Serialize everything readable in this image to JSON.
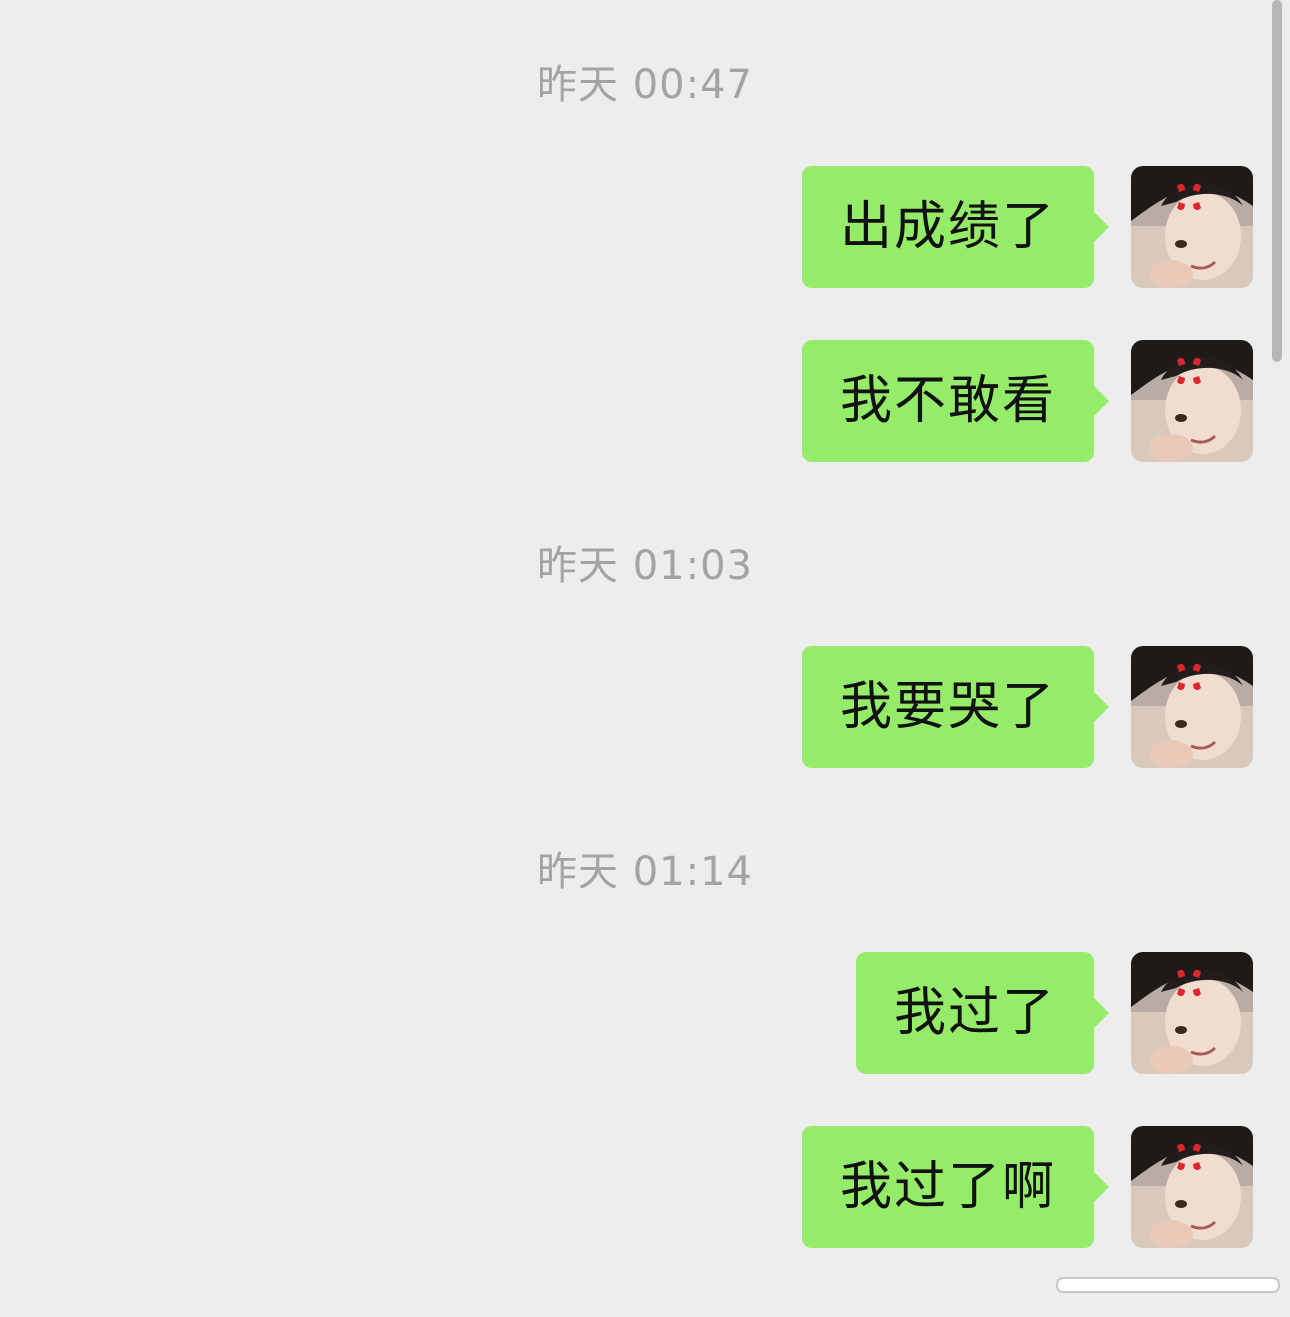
{
  "chat": {
    "groups": [
      {
        "timestamp": "昨天 00:47",
        "messages": [
          "出成绩了",
          "我不敢看"
        ]
      },
      {
        "timestamp": "昨天 01:03",
        "messages": [
          "我要哭了"
        ]
      },
      {
        "timestamp": "昨天 01:14",
        "messages": [
          "我过了",
          "我过了啊"
        ]
      }
    ]
  },
  "colors": {
    "background": "#ededed",
    "bubble": "#95ec69",
    "timestamp_text": "#a3a3a3",
    "message_text": "#111111"
  },
  "icons": {
    "avatar": "avatar-photo-with-anger-icon"
  }
}
